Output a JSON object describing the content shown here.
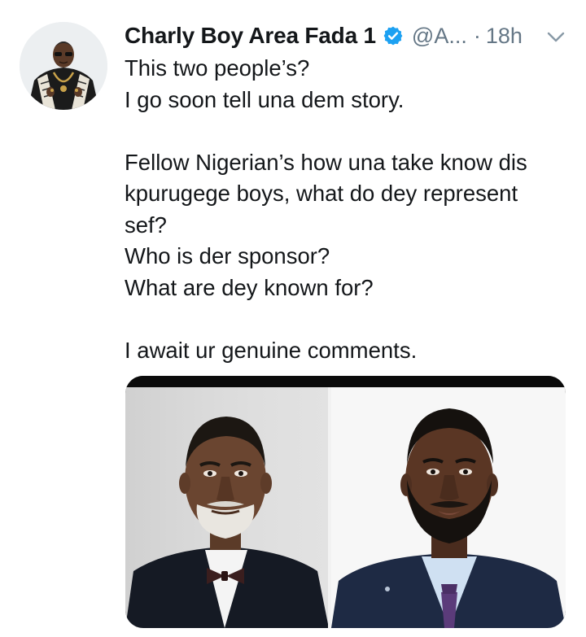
{
  "tweet": {
    "author": {
      "display_name": "Charly Boy Area Fada 1",
      "handle": "@A...",
      "verified": true
    },
    "separator": "·",
    "time": "18h",
    "text_lines": [
      "This two people’s?",
      "I go soon tell una dem story.",
      "",
      "Fellow Nigerian’s how una take know dis",
      "kpurugege boys, what do dey represent",
      "sef?",
      "Who is der sponsor?",
      "What are dey known for?",
      "",
      "I await ur genuine comments."
    ],
    "icons": {
      "verified": "verified-badge-icon",
      "caret": "chevron-down-icon"
    },
    "colors": {
      "verified_blue": "#1DA1F2",
      "secondary_text": "#657786",
      "primary_text": "#14171A"
    }
  }
}
